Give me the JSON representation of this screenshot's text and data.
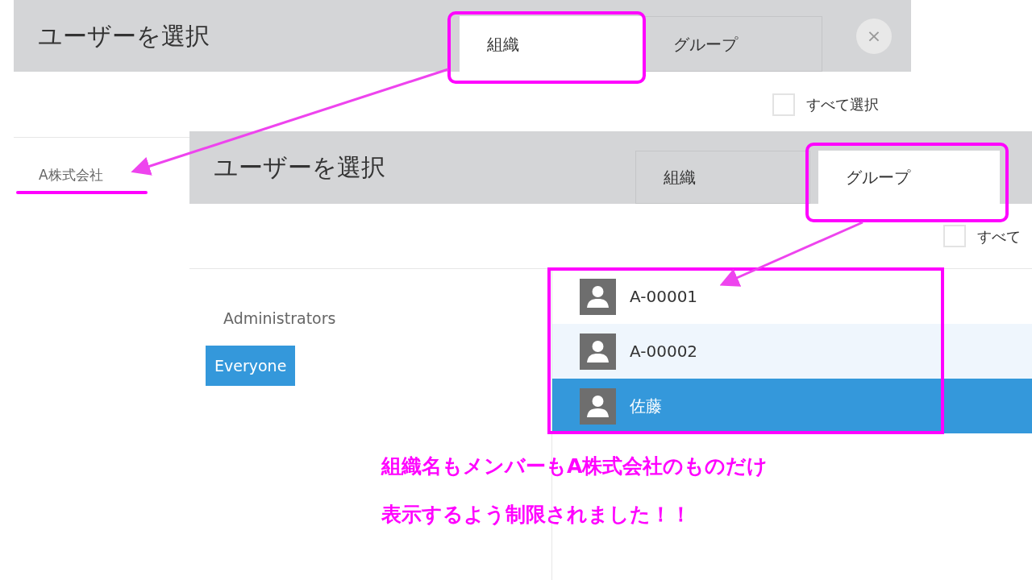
{
  "dialogs": [
    {
      "title": "ユーザーを選択",
      "tabs": [
        {
          "label": "組織",
          "selected": true
        },
        {
          "label": "グループ",
          "selected": false
        }
      ],
      "close_label": "×",
      "select_all": {
        "label": "すべて選択",
        "checked": false
      },
      "list": [
        {
          "label": "A株式会社",
          "selected": false
        }
      ]
    },
    {
      "title": "ユーザーを選択",
      "tabs": [
        {
          "label": "組織",
          "selected": false
        },
        {
          "label": "グループ",
          "selected": true
        }
      ],
      "select_all": {
        "label": "すべて",
        "checked": false
      },
      "list": [
        {
          "label": "Administrators",
          "selected": false
        },
        {
          "label": "Everyone",
          "selected": true
        }
      ],
      "members": [
        {
          "name": "A-00001",
          "selected": false,
          "highlighted": false
        },
        {
          "name": "A-00002",
          "selected": false,
          "highlighted": true
        },
        {
          "name": "佐藤",
          "selected": true,
          "highlighted": false
        }
      ]
    }
  ],
  "caption": [
    "組織名もメンバーもA株式会社のものだけ",
    "表示するよう制限されました！！"
  ]
}
